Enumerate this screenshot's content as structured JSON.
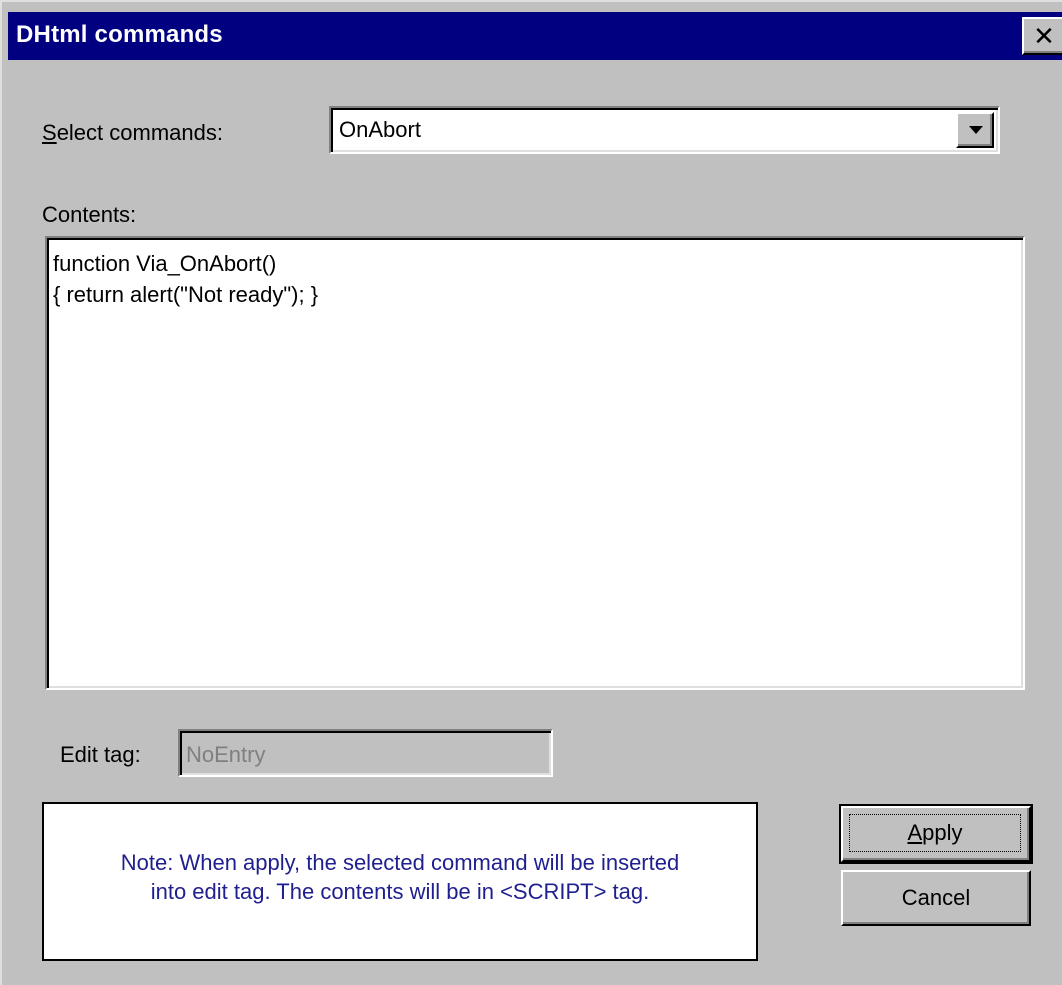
{
  "window": {
    "title": "DHtml commands",
    "close_glyph": "✕"
  },
  "select_commands": {
    "label_first": "S",
    "label_rest": "elect commands:",
    "value": "OnAbort"
  },
  "contents": {
    "label": "Contents:",
    "lines": [
      "function Via_OnAbort()",
      "{ return alert(\"Not ready\"); }"
    ]
  },
  "edit_tag": {
    "label": "Edit tag:",
    "value": "NoEntry"
  },
  "note": {
    "line1": "Note: When apply,  the selected command will be inserted",
    "line2": "into edit tag. The contents will be in <SCRIPT> tag."
  },
  "buttons": {
    "apply_first": "A",
    "apply_rest": "pply",
    "cancel": "Cancel"
  },
  "colors": {
    "titlebar": "#000080",
    "face": "#c0c0c0",
    "note_text": "#1f1f8f"
  },
  "icons": {
    "close": "close-icon",
    "dropdown": "dropdown-arrow-icon"
  }
}
